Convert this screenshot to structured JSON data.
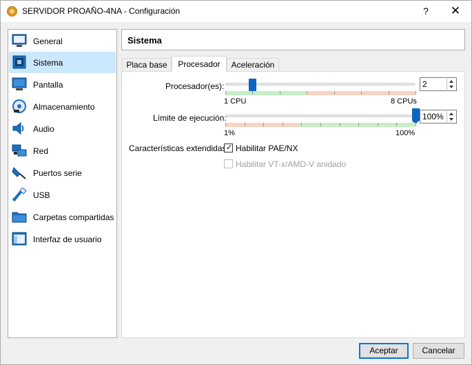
{
  "window": {
    "title": "SERVIDOR PROAÑO-4NA - Configuración",
    "help_label": "?",
    "close_label": "✕"
  },
  "sidebar": {
    "items": [
      {
        "label": "General",
        "icon": "general-icon"
      },
      {
        "label": "Sistema",
        "icon": "system-icon",
        "selected": true
      },
      {
        "label": "Pantalla",
        "icon": "display-icon"
      },
      {
        "label": "Almacenamiento",
        "icon": "storage-icon"
      },
      {
        "label": "Audio",
        "icon": "audio-icon"
      },
      {
        "label": "Red",
        "icon": "network-icon"
      },
      {
        "label": "Puertos serie",
        "icon": "serial-ports-icon"
      },
      {
        "label": "USB",
        "icon": "usb-icon"
      },
      {
        "label": "Carpetas compartidas",
        "icon": "shared-folders-icon"
      },
      {
        "label": "Interfaz de usuario",
        "icon": "user-interface-icon"
      }
    ]
  },
  "header": {
    "title": "Sistema"
  },
  "tabs": [
    {
      "label": "Placa base"
    },
    {
      "label": "Procesador",
      "active": true
    },
    {
      "label": "Aceleración"
    }
  ],
  "processor": {
    "label": "Procesador(es):",
    "value": "2",
    "min_label": "1 CPU",
    "max_label": "8 CPUs",
    "count": 2,
    "min": 1,
    "max": 8
  },
  "exec_cap": {
    "label": "Límite de ejecución:",
    "value": "100%",
    "min_label": "1%",
    "max_label": "100%",
    "percent": 100
  },
  "extended": {
    "label": "Características extendidas:",
    "pae_label": "Habilitar PAE/NX",
    "pae_checked": true,
    "vtx_label": "Habilitar VT-x/AMD-V anidado",
    "vtx_checked": false
  },
  "buttons": {
    "accept": "Aceptar",
    "cancel": "Cancelar"
  },
  "colors": {
    "accent": "#0078d7",
    "thumb": "#0a66c2",
    "selected_bg": "#cce8ff",
    "range_ok": "#c6efc6",
    "range_warn": "#f9d3c0"
  }
}
